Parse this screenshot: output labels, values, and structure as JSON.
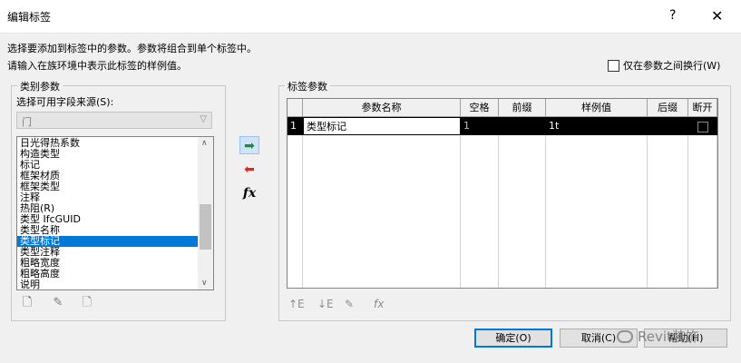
{
  "window": {
    "title": "编辑标签",
    "help_glyph": "?",
    "close_glyph": "✕"
  },
  "description": {
    "line1": "选择要添加到标签中的参数。参数将组合到单个标签中。",
    "line2": "请输入在族环境中表示此标签的样例值。"
  },
  "wrap_option": {
    "label": "仅在参数之间换行(W)",
    "checked": false
  },
  "category_group": {
    "legend": "类别参数",
    "source_label": "选择可用字段来源(S):",
    "source_value": "门",
    "fields": [
      "日光得热系数",
      "构造类型",
      "标记",
      "框架材质",
      "框架类型",
      "注释",
      "热阻(R)",
      "类型 IfcGUID",
      "类型名称",
      "类型标记",
      "类型注释",
      "粗略宽度",
      "粗略高度",
      "说明"
    ],
    "selected_index": 9
  },
  "label_group": {
    "legend": "标签参数",
    "columns": [
      "参数名称",
      "空格",
      "前缀",
      "样例值",
      "后缀",
      "断开"
    ],
    "rows": [
      {
        "index": "1",
        "name": "类型标记",
        "spaces": "1",
        "prefix": "",
        "sample": "1t",
        "suffix": "",
        "break": false
      }
    ]
  },
  "buttons": {
    "ok": "确定(O)",
    "cancel": "取消(C)",
    "help": "帮助(H)"
  },
  "watermark": "Revit装饰",
  "icons": {
    "add_parameter": "arrow-right-add-icon",
    "remove_parameter": "arrow-left-remove-icon",
    "formula": "fx-icon"
  }
}
